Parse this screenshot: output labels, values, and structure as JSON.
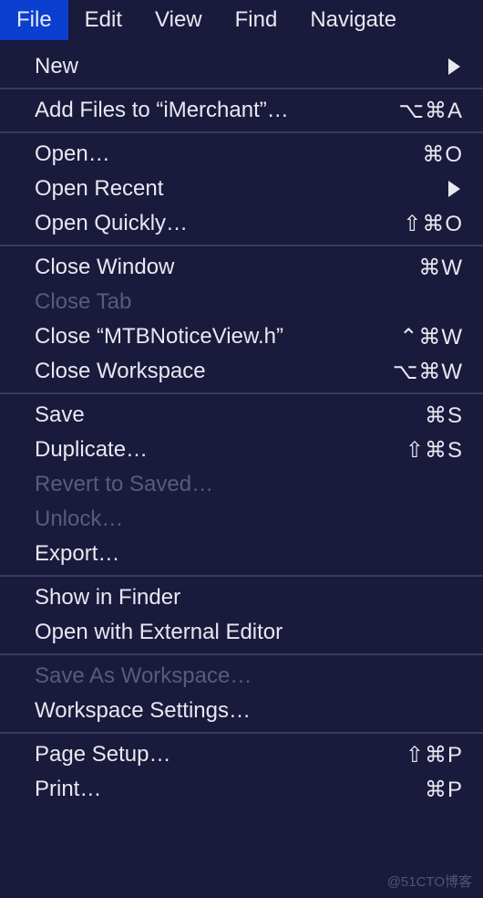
{
  "menubar": {
    "items": [
      {
        "label": "File",
        "active": true
      },
      {
        "label": "Edit",
        "active": false
      },
      {
        "label": "View",
        "active": false
      },
      {
        "label": "Find",
        "active": false
      },
      {
        "label": "Navigate",
        "active": false
      }
    ]
  },
  "menu": {
    "sections": [
      [
        {
          "label": "New",
          "shortcut": "",
          "submenu": true,
          "disabled": false
        }
      ],
      [
        {
          "label": "Add Files to “iMerchant”…",
          "shortcut": "⌥⌘A",
          "submenu": false,
          "disabled": false
        }
      ],
      [
        {
          "label": "Open…",
          "shortcut": "⌘O",
          "submenu": false,
          "disabled": false
        },
        {
          "label": "Open Recent",
          "shortcut": "",
          "submenu": true,
          "disabled": false
        },
        {
          "label": "Open Quickly…",
          "shortcut": "⇧⌘O",
          "submenu": false,
          "disabled": false
        }
      ],
      [
        {
          "label": "Close Window",
          "shortcut": "⌘W",
          "submenu": false,
          "disabled": false
        },
        {
          "label": "Close Tab",
          "shortcut": "",
          "submenu": false,
          "disabled": true
        },
        {
          "label": "Close “MTBNoticeView.h”",
          "shortcut": "⌃⌘W",
          "submenu": false,
          "disabled": false
        },
        {
          "label": "Close Workspace",
          "shortcut": "⌥⌘W",
          "submenu": false,
          "disabled": false
        }
      ],
      [
        {
          "label": "Save",
          "shortcut": "⌘S",
          "submenu": false,
          "disabled": false
        },
        {
          "label": "Duplicate…",
          "shortcut": "⇧⌘S",
          "submenu": false,
          "disabled": false
        },
        {
          "label": "Revert to Saved…",
          "shortcut": "",
          "submenu": false,
          "disabled": true
        },
        {
          "label": "Unlock…",
          "shortcut": "",
          "submenu": false,
          "disabled": true
        },
        {
          "label": "Export…",
          "shortcut": "",
          "submenu": false,
          "disabled": false
        }
      ],
      [
        {
          "label": "Show in Finder",
          "shortcut": "",
          "submenu": false,
          "disabled": false
        },
        {
          "label": "Open with External Editor",
          "shortcut": "",
          "submenu": false,
          "disabled": false
        }
      ],
      [
        {
          "label": "Save As Workspace…",
          "shortcut": "",
          "submenu": false,
          "disabled": true
        },
        {
          "label": "Workspace Settings…",
          "shortcut": "",
          "submenu": false,
          "disabled": false
        }
      ],
      [
        {
          "label": "Page Setup…",
          "shortcut": "⇧⌘P",
          "submenu": false,
          "disabled": false
        },
        {
          "label": "Print…",
          "shortcut": "⌘P",
          "submenu": false,
          "disabled": false
        }
      ]
    ]
  },
  "watermark": "@51CTO博客"
}
